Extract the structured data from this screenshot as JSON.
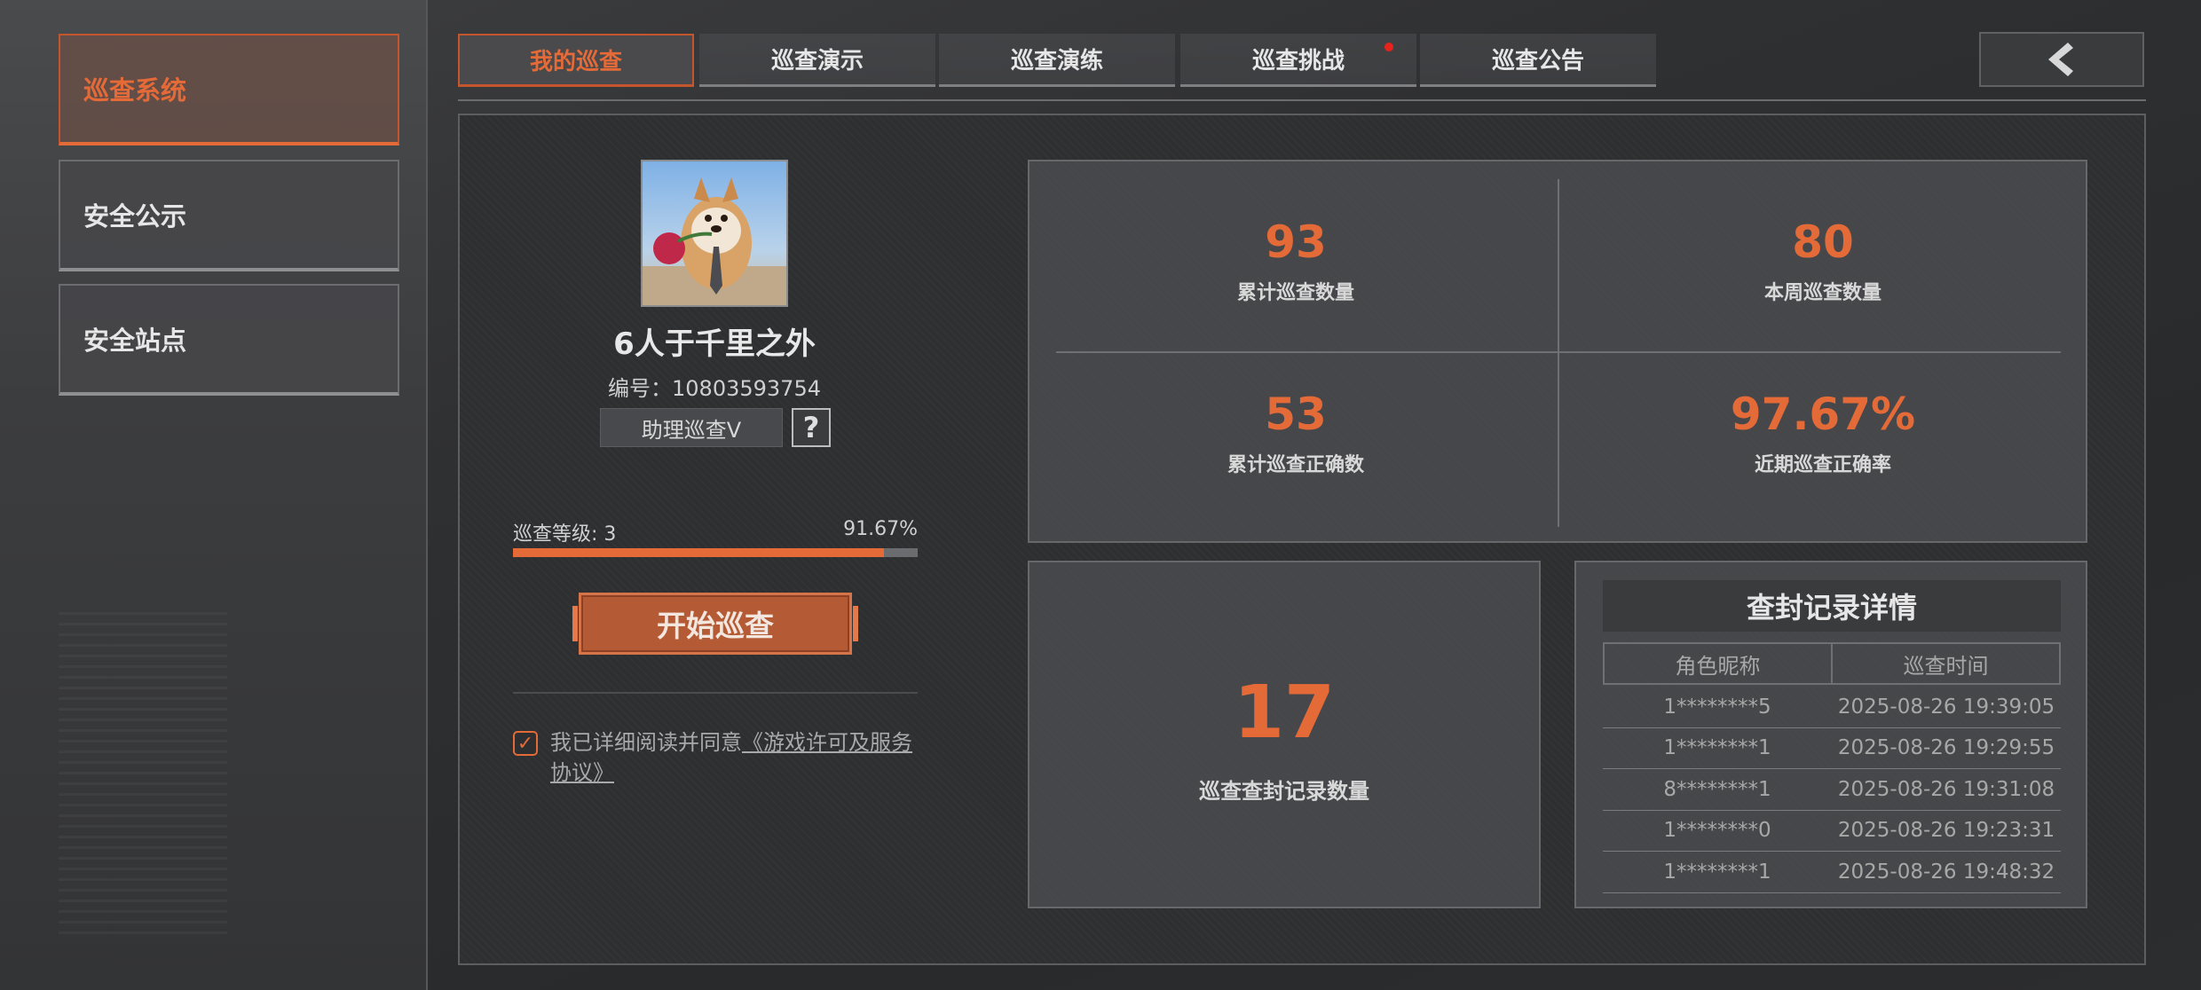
{
  "sidebar": {
    "items": [
      {
        "label": "巡查系统",
        "active": true
      },
      {
        "label": "安全公示",
        "active": false
      },
      {
        "label": "安全站点",
        "active": false
      }
    ]
  },
  "tabs": [
    {
      "label": "我的巡查",
      "active": true
    },
    {
      "label": "巡查演示",
      "active": false
    },
    {
      "label": "巡查演练",
      "active": false
    },
    {
      "label": "巡查挑战",
      "active": false,
      "badge": true
    },
    {
      "label": "巡查公告",
      "active": false
    }
  ],
  "header": {
    "back_icon": "chevron-left-icon"
  },
  "profile": {
    "name": "6人于千里之外",
    "id_text": "编号：10803593754",
    "role": "助理巡查V",
    "help_symbol": "?",
    "level_label": "巡查等级: 3",
    "level_percent_text": "91.67%",
    "level_progress": 0.9167,
    "start_button": "开始巡查",
    "agree_prefix": "我已详细阅读并同意",
    "agree_link": "《游戏许可及服务协议》",
    "agree_checked": true
  },
  "stats": [
    {
      "value": "93",
      "label": "累计巡查数量"
    },
    {
      "value": "80",
      "label": "本周巡查数量"
    },
    {
      "value": "53",
      "label": "累计巡查正确数"
    },
    {
      "value": "97.67%",
      "label": "近期巡查正确率"
    }
  ],
  "ban_count": {
    "value": "17",
    "label": "巡查查封记录数量"
  },
  "records": {
    "title": "查封记录详情",
    "columns": [
      "角色昵称",
      "巡查时间"
    ],
    "rows": [
      {
        "name": "1********5",
        "time": "2025-08-26 19:39:05"
      },
      {
        "name": "1********1",
        "time": "2025-08-26 19:29:55"
      },
      {
        "name": "8********1",
        "time": "2025-08-26 19:31:08"
      },
      {
        "name": "1********0",
        "time": "2025-08-26 19:23:31"
      },
      {
        "name": "1********1",
        "time": "2025-08-26 19:48:32"
      }
    ]
  },
  "colors": {
    "accent": "#e46a38",
    "badge": "#e8231d",
    "panel": "#505154"
  }
}
